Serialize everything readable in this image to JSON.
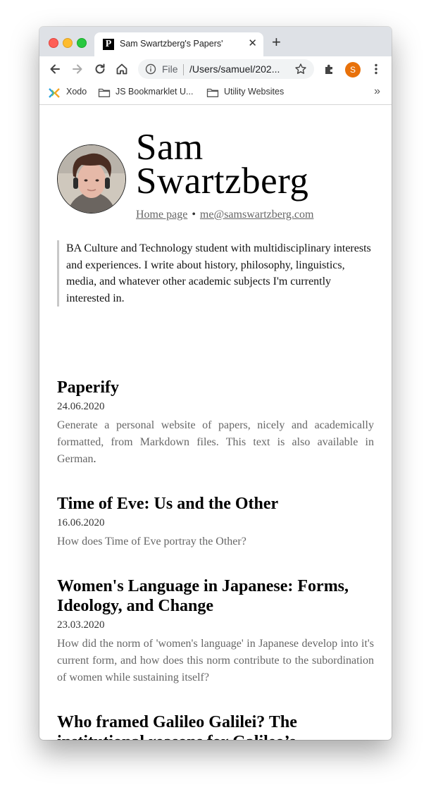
{
  "browser": {
    "tab_title": "Sam Swartzberg's Papers'",
    "tab_favicon": "P",
    "omnibox_scheme": "File",
    "omnibox_url": "/Users/samuel/202...",
    "profile_initial": "S",
    "bookmarks": [
      "Xodo",
      "JS Bookmarklet U...",
      "Utility Websites"
    ],
    "bookmarks_overflow": "»"
  },
  "profile": {
    "name_line1": "Sam",
    "name_line2": "Swartzberg",
    "home_link": "Home page",
    "separator": "•",
    "email": "me@samswartzberg.com",
    "bio": "BA Culture and Technology student with multidisciplinary interests and experiences. I write about history, philosophy, linguistics, media, and whatever other academic subjects I'm currently interested in."
  },
  "posts": [
    {
      "title": "Paperify",
      "date": "24.06.2020",
      "description": "Generate a personal website of papers, nicely and academically formatted, from Markdown files. This text is also available in German",
      "description_end": "."
    },
    {
      "title": "Time of Eve: Us and the Other",
      "date": "16.06.2020",
      "description": "How does Time of Eve portray the Other?"
    },
    {
      "title": "Women's Language in Japanese: Forms, Ideology, and Change",
      "date": "23.03.2020",
      "description": "How did the norm of 'women's language' in Japanese develop into it's current form, and how does this norm contribute to the subordination of women while sustaining itself?"
    },
    {
      "title": "Who framed Galileo Galilei? The institutional reasons for Galileo’s conviction."
    }
  ],
  "colors": {
    "tabstrip": "#dee1e6",
    "profile_badge": "#e8710a",
    "muted_text": "#666666"
  },
  "icons": [
    "back-arrow-icon",
    "forward-arrow-icon",
    "reload-icon",
    "home-icon",
    "info-icon",
    "star-icon",
    "extensions-icon",
    "menu-dots-icon",
    "xodo-icon",
    "folder-icon",
    "close-icon",
    "plus-icon"
  ]
}
